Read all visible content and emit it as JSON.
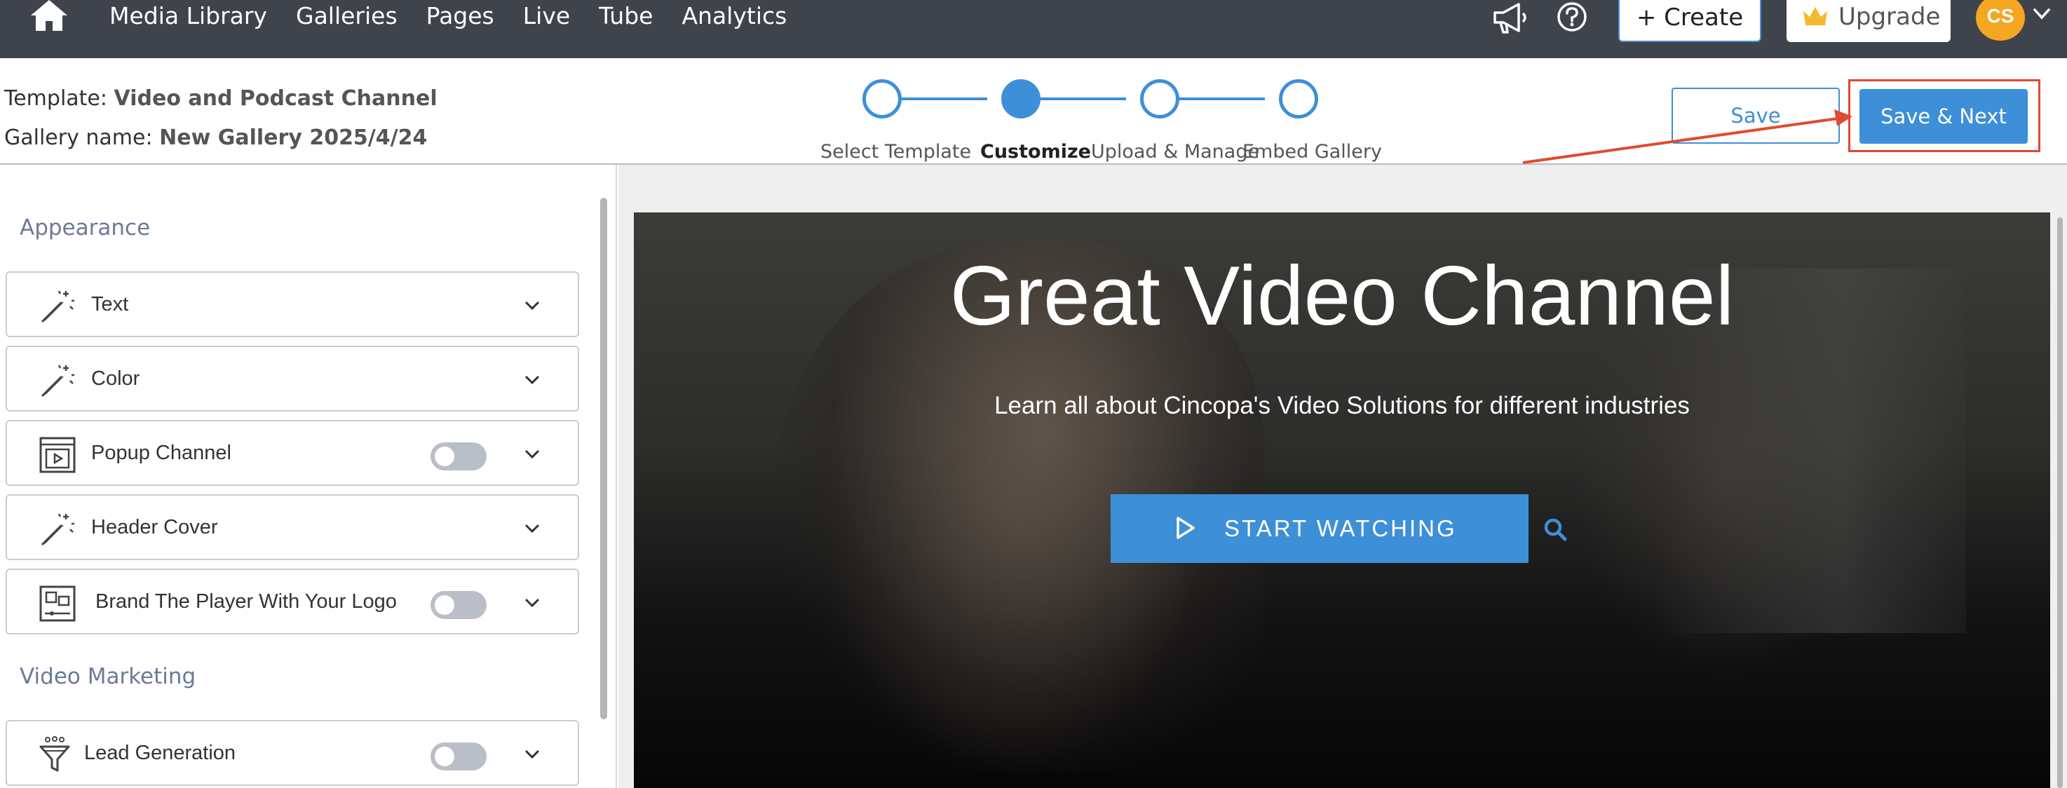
{
  "nav": {
    "links": [
      "Media Library",
      "Galleries",
      "Pages",
      "Live",
      "Tube",
      "Analytics"
    ],
    "create_label": "+ Create",
    "upgrade_label": "Upgrade",
    "avatar_initials": "CS"
  },
  "subheader": {
    "template_prefix": "Template:",
    "template_name": "Video and Podcast Channel",
    "gallery_prefix": "Gallery name:",
    "gallery_name": "New Gallery 2025/4/24",
    "steps": [
      "Select Template",
      "Customize",
      "Upload & Manage",
      "Embed Gallery"
    ],
    "active_step": 1,
    "save_label": "Save",
    "save_next_label": "Save & Next"
  },
  "sidebar": {
    "sections": [
      "Appearance",
      "Video Marketing"
    ],
    "items": [
      {
        "label": "Text",
        "icon": "magic-wand-icon",
        "toggle": false
      },
      {
        "label": "Color",
        "icon": "magic-wand-icon",
        "toggle": false
      },
      {
        "label": "Popup Channel",
        "icon": "popup-player-icon",
        "toggle": true
      },
      {
        "label": "Header Cover",
        "icon": "magic-wand-icon",
        "toggle": false
      },
      {
        "label": "Brand The Player With Your Logo",
        "icon": "brand-player-icon",
        "toggle": true
      },
      {
        "label": "Lead Generation",
        "icon": "funnel-icon",
        "toggle": true
      }
    ]
  },
  "preview": {
    "title": "Great Video Channel",
    "subtitle": "Learn all about Cincopa's Video Solutions for different industries",
    "cta_label": "START WATCHING"
  },
  "colors": {
    "nav_bg": "#3e434c",
    "accent": "#3d8fd8",
    "annotation": "#e04a2f",
    "avatar": "#f5a623"
  }
}
